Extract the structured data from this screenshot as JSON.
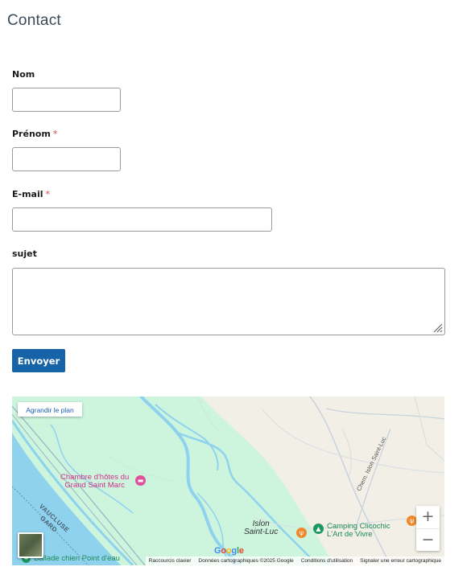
{
  "page": {
    "title": "Contact"
  },
  "form": {
    "nom_label": "Nom",
    "prenom_label": "Prénom",
    "email_label": "E-mail",
    "sujet_label": "sujet",
    "required_mark": "*",
    "submit_label": "Envoyer"
  },
  "map": {
    "enlarge_label": "Agrandir le plan",
    "zoom_in": "+",
    "zoom_out": "−",
    "labels": {
      "chambre_line1": "Chambre d'hôtes du",
      "chambre_line2": "Grand Saint Marc",
      "town_line1": "Islon",
      "town_line2": "Saint-Luc",
      "camping_line1": "Camping Clicochic",
      "camping_line2": "L'Art de Vivre",
      "road": "Chem. Islon Saint-Luc",
      "region_line1": "VAUCLUSE",
      "region_line2": "GARD",
      "balade": "Ballade chien Point d'eau"
    },
    "attribution": {
      "shortcuts": "Raccourcis clavier",
      "data": "Données cartographiques ©2025 Google",
      "terms": "Conditions d'utilisation",
      "report": "Signaler une erreur cartographique"
    },
    "logo_text": "Google",
    "colors": {
      "water": "#8fd2ee",
      "park": "#cdf5dd",
      "land": "#f1efe6",
      "button": "#1763a8",
      "poi_pink": "#d22f8e",
      "poi_green": "#1c8b57",
      "poi_orange": "#ef8a2c"
    }
  }
}
